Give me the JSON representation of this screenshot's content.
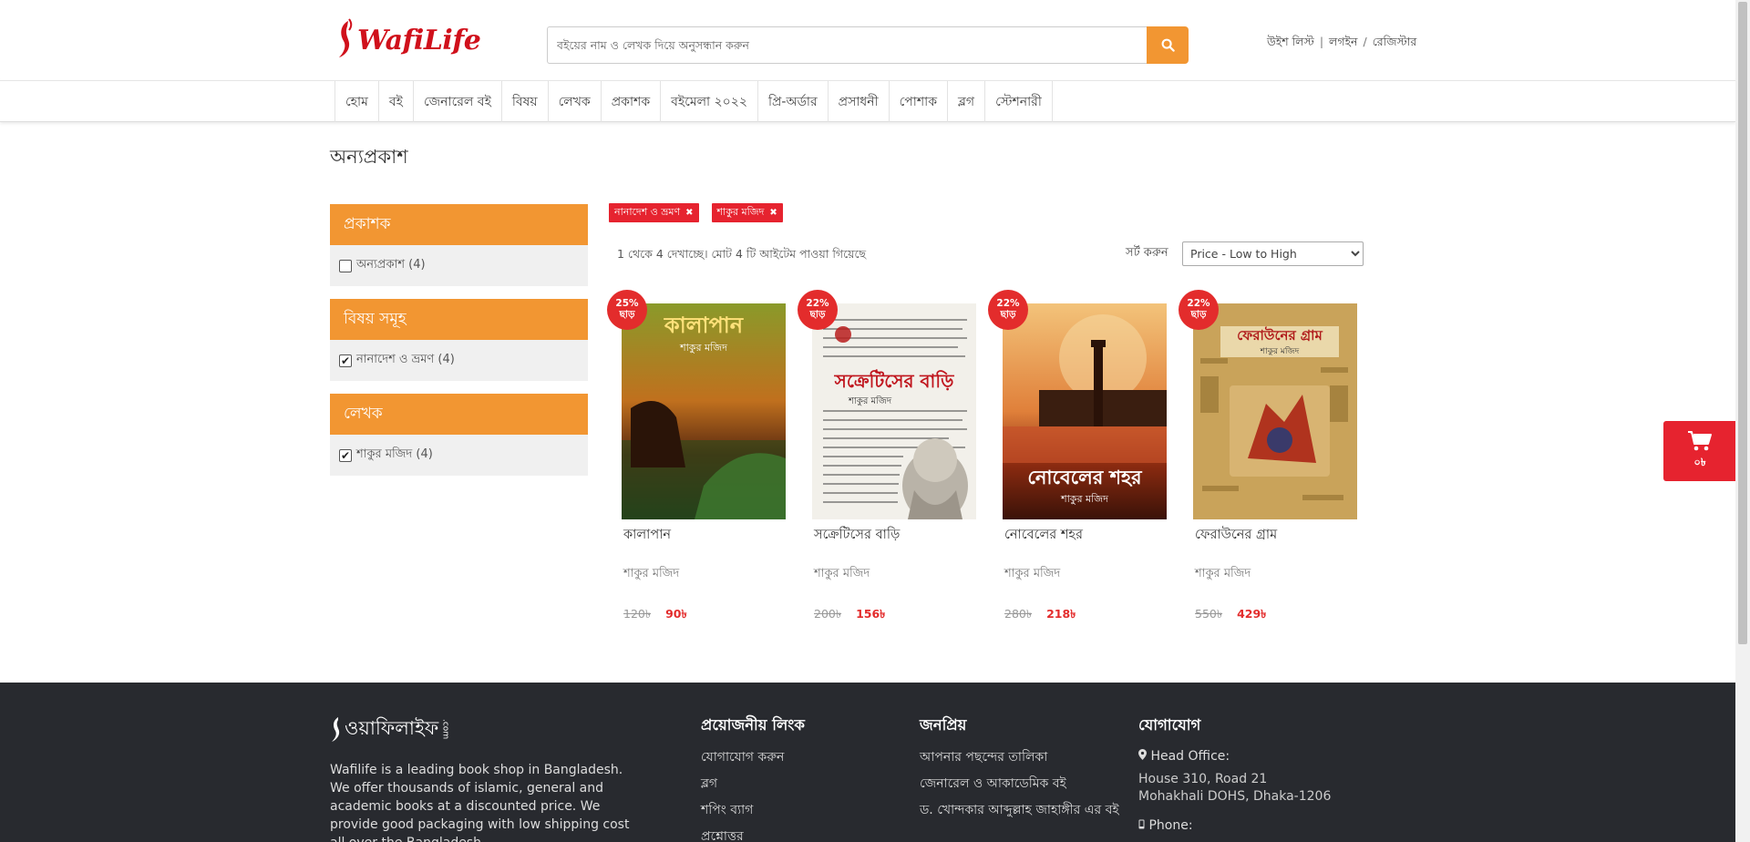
{
  "header": {
    "logo_text": "WafiLife",
    "search_placeholder": "বইয়ের নাম ও লেখক দিয়ে অনুসন্ধান করুন",
    "wishlist": "উইশ লিস্ট",
    "login": "লগইন",
    "register": "রেজিস্টার"
  },
  "nav": [
    "হোম",
    "বই",
    "জেনারেল বই",
    "বিষয়",
    "লেখক",
    "প্রকাশক",
    "বইমেলা ২০২২",
    "প্রি-অর্ডার",
    "প্রসাধনী",
    "পোশাক",
    "ব্লগ",
    "স্টেশনারী"
  ],
  "page_title": "অন্যপ্রকাশ",
  "sidebar": [
    {
      "heading": "প্রকাশক",
      "option": "অন্যপ্রকাশ (4)",
      "checked": false
    },
    {
      "heading": "বিষয় সমূহ",
      "option": "নানাদেশ ও ভ্রমণ (4)",
      "checked": true
    },
    {
      "heading": "লেখক",
      "option": "শাকুর মজিদ (4)",
      "checked": true
    }
  ],
  "active_filters": [
    "নানাদেশ ও ভ্রমণ",
    "শাকুর মজিদ"
  ],
  "result_count": "1 থেকে 4 দেখাচ্ছে। মোট 4 টি আইটেম পাওয়া গিয়েছে",
  "sort": {
    "label": "সর্ট করুন",
    "selected": "Price - Low to High"
  },
  "discount_suffix": "ছাড়",
  "products": [
    {
      "title": "কালাপান",
      "author": "শাকুর মজিদ",
      "discount": "25%",
      "old_price": "120৳",
      "price": "90৳",
      "cover_title": "কালাপান"
    },
    {
      "title": "সক্রেটিসের বাড়ি",
      "author": "শাকুর মজিদ",
      "discount": "22%",
      "old_price": "200৳",
      "price": "156৳",
      "cover_title": "সক্রেটিসের বাড়ি"
    },
    {
      "title": "নোবেলের শহর",
      "author": "শাকুর মজিদ",
      "discount": "22%",
      "old_price": "280৳",
      "price": "218৳",
      "cover_title": "নোবেলের শহর"
    },
    {
      "title": "ফেরাউনের গ্রাম",
      "author": "শাকুর মজিদ",
      "discount": "22%",
      "old_price": "550৳",
      "price": "429৳",
      "cover_title": "ফেরাউনের গ্রাম"
    }
  ],
  "cart": {
    "count": "০৳"
  },
  "footer": {
    "logo_text": "ওয়াফিলাইফ",
    "logo_sub": ".com",
    "description": "Wafilife is a leading book shop in Bangladesh. We offer thousands of islamic, general and academic books at a discounted price. We provide good packaging with low shipping cost all over the Bangladesh.",
    "links_heading": "প্রয়োজনীয় লিংক",
    "links": [
      "যোগাযোগ করুন",
      "ব্লগ",
      "শপিং ব্যাগ",
      "প্রশ্নোত্তর"
    ],
    "popular_heading": "জনপ্রিয়",
    "popular": [
      "আপনার পছন্দের তালিকা",
      "জেনারেল ও আকাডেমিক বই",
      "ড. খোন্দকার আব্দুল্লাহ জাহাঙ্গীর এর বই"
    ],
    "contact_heading": "যোগাযোগ",
    "head_office_label": "Head Office:",
    "address_line1": "House 310, Road 21",
    "address_line2": "Mohakhali DOHS, Dhaka-1206",
    "phone_label": "Phone:"
  },
  "colors": {
    "brand_orange": "#f29632",
    "brand_red": "#e6232f",
    "footer_bg": "#282a2f"
  }
}
